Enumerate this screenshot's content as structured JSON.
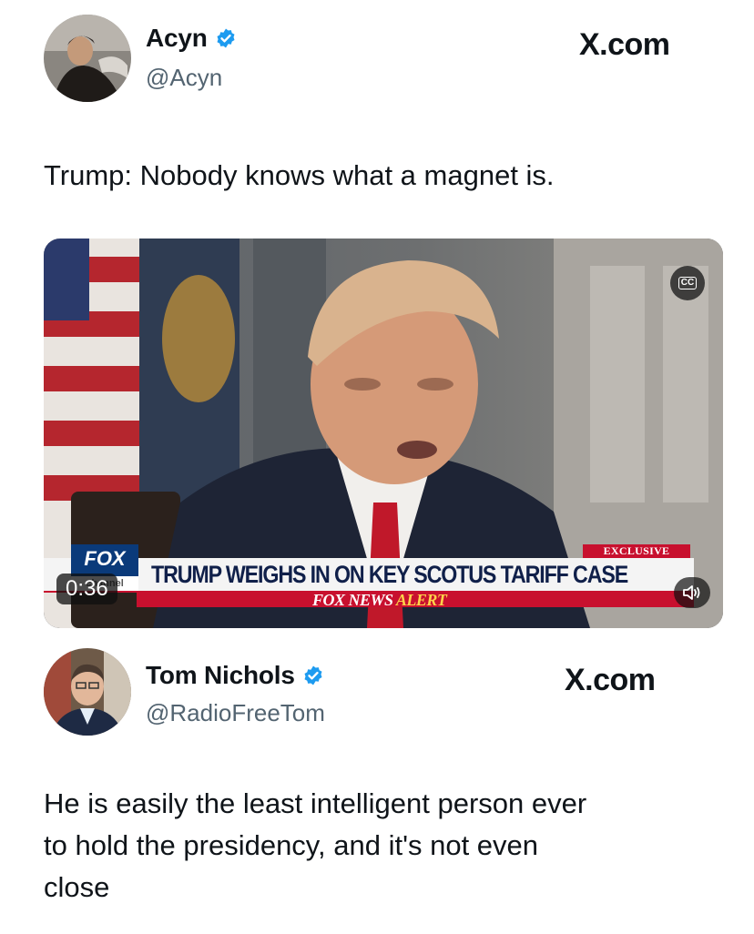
{
  "posts": [
    {
      "author": {
        "name": "Acyn",
        "handle": "@Acyn",
        "verified": true,
        "avatar_icon": "avatar-photo"
      },
      "site": "X.com",
      "text": "Trump: Nobody knows what a magnet is.",
      "video": {
        "captions_icon": "cc-icon",
        "captions_label": "CC",
        "duration": "0:36",
        "mute_icon": "speaker-muted-icon",
        "chyron": {
          "tag": "EXCLUSIVE",
          "headline": "TRUMP WEIGHS IN ON KEY SCOTUS TARIFF CASE",
          "network": "FOX",
          "network_sub": "channel",
          "alert_prefix": "FOX NEWS",
          "alert_word": "ALERT"
        }
      }
    },
    {
      "author": {
        "name": "Tom Nichols",
        "handle": "@RadioFreeTom",
        "verified": true,
        "avatar_icon": "avatar-photo"
      },
      "site": "X.com",
      "text_lines": [
        "He is easily the least intelligent person ever",
        "to hold the presidency, and it's not even",
        "close"
      ]
    }
  ],
  "colors": {
    "verified": "#1d9bf0",
    "handle": "#536471",
    "fox_red": "#c8102e",
    "fox_blue": "#0a3a7a"
  }
}
